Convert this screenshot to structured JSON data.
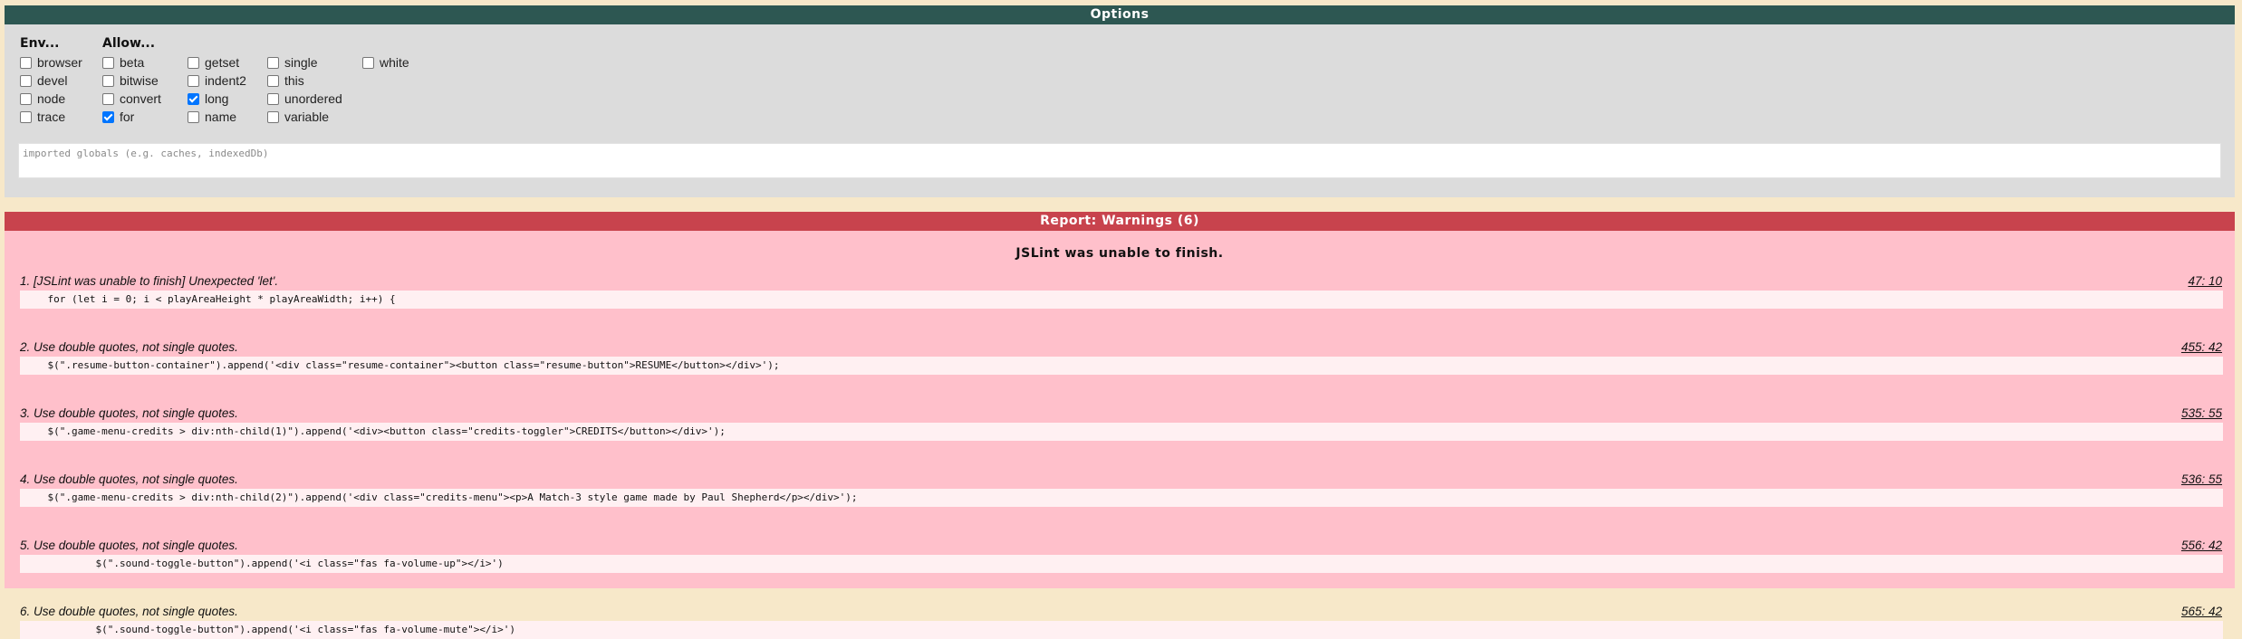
{
  "options": {
    "title": "Options",
    "env_heading": "Env...",
    "allow_heading": "Allow...",
    "env": [
      {
        "label": "browser",
        "checked": false
      },
      {
        "label": "devel",
        "checked": false
      },
      {
        "label": "node",
        "checked": false
      },
      {
        "label": "trace",
        "checked": false
      }
    ],
    "allow_col1": [
      {
        "label": "beta",
        "checked": false
      },
      {
        "label": "bitwise",
        "checked": false
      },
      {
        "label": "convert",
        "checked": false
      },
      {
        "label": "for",
        "checked": true
      }
    ],
    "allow_col2": [
      {
        "label": "getset",
        "checked": false
      },
      {
        "label": "indent2",
        "checked": false
      },
      {
        "label": "long",
        "checked": true
      },
      {
        "label": "name",
        "checked": false
      }
    ],
    "allow_col3": [
      {
        "label": "single",
        "checked": false
      },
      {
        "label": "this",
        "checked": false
      },
      {
        "label": "unordered",
        "checked": false
      },
      {
        "label": "variable",
        "checked": false
      }
    ],
    "allow_col4": [
      {
        "label": "white",
        "checked": false
      }
    ],
    "globals_placeholder": "imported globals (e.g. caches, indexedDb)"
  },
  "report": {
    "title": "Report: Warnings (6)",
    "heading": "JSLint was unable to finish.",
    "warnings": [
      {
        "message": "1. [JSLint was unable to finish] Unexpected 'let'.",
        "location": "47: 10",
        "code": "    for (let i = 0; i < playAreaHeight * playAreaWidth; i++) {"
      },
      {
        "message": "2. Use double quotes, not single quotes.",
        "location": "455: 42",
        "code": "    $(\".resume-button-container\").append('<div class=\"resume-container\"><button class=\"resume-button\">RESUME</button></div>');"
      },
      {
        "message": "3. Use double quotes, not single quotes.",
        "location": "535: 55",
        "code": "    $(\".game-menu-credits > div:nth-child(1)\").append('<div><button class=\"credits-toggler\">CREDITS</button></div>');"
      },
      {
        "message": "4. Use double quotes, not single quotes.",
        "location": "536: 55",
        "code": "    $(\".game-menu-credits > div:nth-child(2)\").append('<div class=\"credits-menu\"><p>A Match-3 style game made by Paul Shepherd</p></div>');"
      },
      {
        "message": "5. Use double quotes, not single quotes.",
        "location": "556: 42",
        "code": "            $(\".sound-toggle-button\").append('<i class=\"fas fa-volume-up\"></i>')"
      },
      {
        "message": "6. Use double quotes, not single quotes.",
        "location": "565: 42",
        "code": "            $(\".sound-toggle-button\").append('<i class=\"fas fa-volume-mute\"></i>')"
      }
    ]
  },
  "colors": {
    "options_header": "#2d5752",
    "report_header": "#c8434d",
    "report_bg": "#ffc0cb",
    "options_bg": "#dcdcdc",
    "page_bg": "#f7e8c9"
  }
}
